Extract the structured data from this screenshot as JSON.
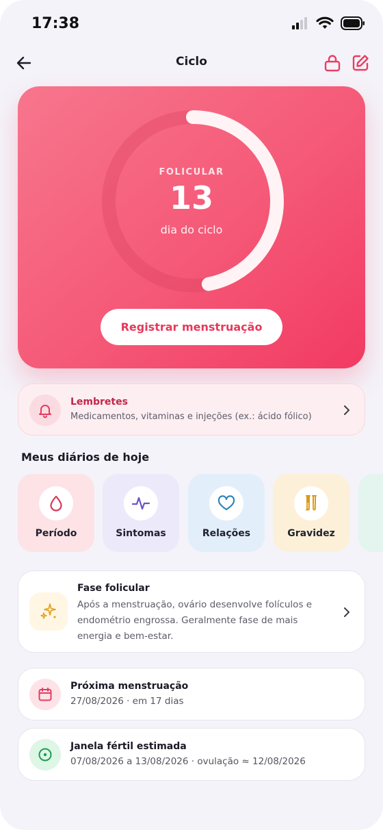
{
  "status_bar": {
    "time": "17:38",
    "icons": [
      "cellular-signal-icon",
      "wifi-icon",
      "battery-icon"
    ]
  },
  "header": {
    "title": "Ciclo",
    "back_icon": "arrow-left-icon",
    "lock_icon": "lock-icon",
    "edit_icon": "edit-icon"
  },
  "hero": {
    "phase_label": "FOLICULAR",
    "cycle_day": "13",
    "cycle_caption": "dia do ciclo",
    "progress_fraction": 0.47,
    "button_label": "Registrar menstruação"
  },
  "reminders": {
    "title": "Lembretes",
    "subtitle": "Medicamentos, vitaminas e injeções (ex.: ácido fólico)",
    "icon": "bell-icon"
  },
  "diaries": {
    "section_title": "Meus diários de hoje",
    "items": [
      {
        "label": "Período",
        "icon": "drop-icon",
        "bg": "#fde2e6",
        "color": "#d6385a"
      },
      {
        "label": "Sintomas",
        "icon": "pulse-icon",
        "bg": "#ece9fb",
        "color": "#6b53c9"
      },
      {
        "label": "Relações",
        "icon": "heart-icon",
        "bg": "#e2effb",
        "color": "#2f86b8"
      },
      {
        "label": "Gravidez",
        "icon": "test-tubes-icon",
        "bg": "#fdf0d9",
        "color": "#d99a1e"
      }
    ]
  },
  "phase_card": {
    "title": "Fase folicular",
    "description": "Após a menstruação, ovário desenvolve folículos e endométrio engrossa. Geralmente fase de mais energia e bem-estar.",
    "icon": "sparkles-icon"
  },
  "next_period": {
    "title": "Próxima menstruação",
    "detail": "27/08/2026 · em 17 dias",
    "icon": "calendar-icon"
  },
  "fertile_window": {
    "title": "Janela fértil estimada",
    "detail": "07/08/2026 a 13/08/2026 · ovulação ≈ 12/08/2026",
    "icon": "target-icon"
  },
  "colors": {
    "accent": "#f04a6c",
    "background": "#f4f3f9"
  }
}
